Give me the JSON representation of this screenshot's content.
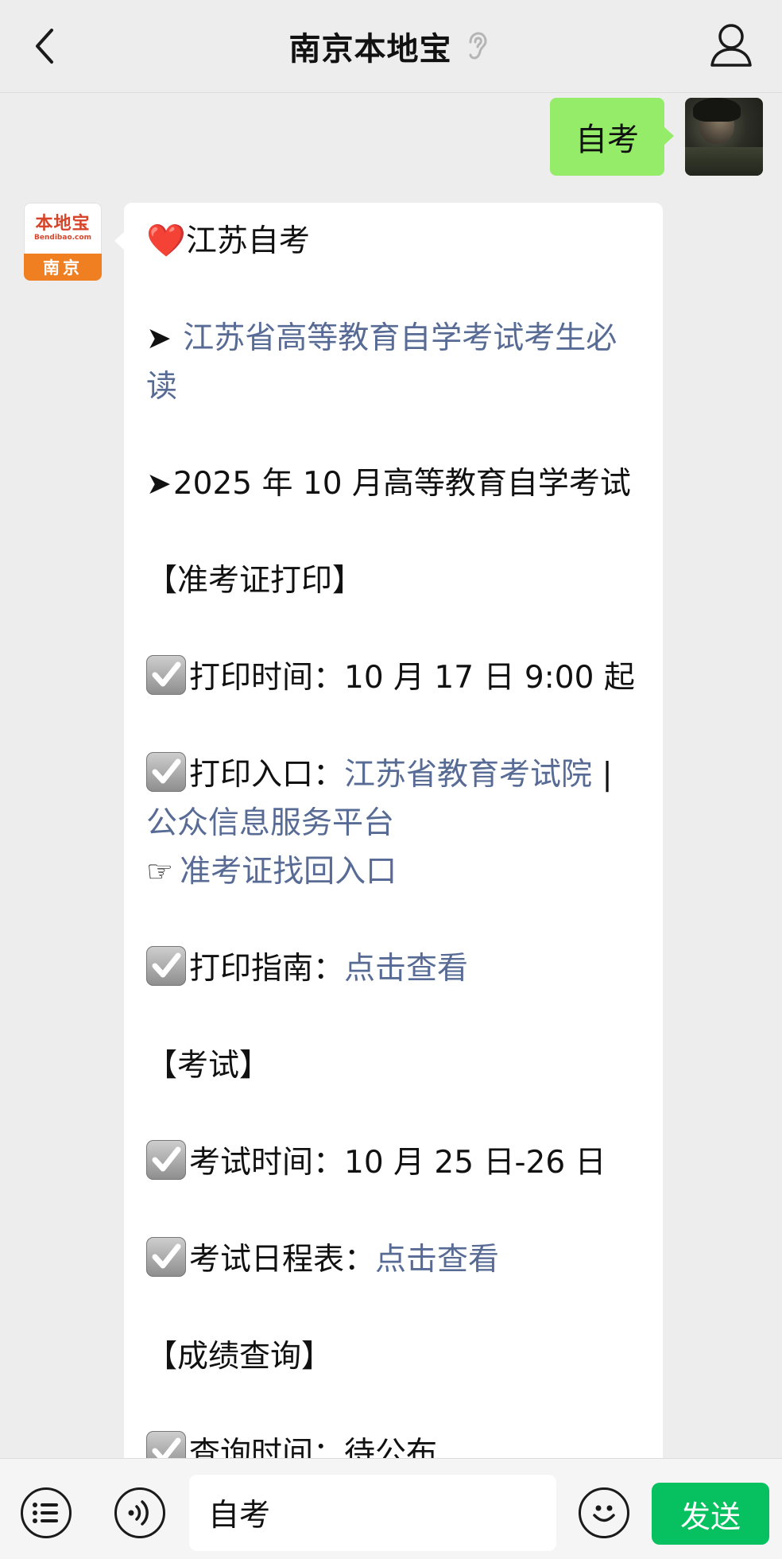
{
  "header": {
    "title": "南京本地宝"
  },
  "chat": {
    "self_message": "自考",
    "bot_avatar": {
      "logo_main": "本地宝",
      "logo_sub": "Bendibao.com",
      "logo_city": "南京"
    },
    "bot_message": {
      "heading": "江苏自考",
      "arrow1": "➤",
      "link_must_read": "江苏省高等教育自学考试考生必读",
      "arrow2": "➤",
      "exam_title": "2025 年 10 月高等教育自学考试",
      "section_admission": "【准考证打印】",
      "print_time_label": "打印时间：",
      "print_time_value": "10 月 17 日 9:00 起",
      "print_entry_label": "打印入口：",
      "print_entry_link1": "江苏省教育考试院",
      "separator": "|",
      "print_entry_link2": "公众信息服务平台",
      "pointer": "☞",
      "retrieve_link": "准考证找回入口",
      "print_guide_label": "打印指南：",
      "print_guide_link": "点击查看",
      "section_exam": "【考试】",
      "exam_time_label": "考试时间：",
      "exam_time_value": "10 月 25 日-26 日",
      "exam_schedule_label": "考试日程表：",
      "exam_schedule_link": "点击查看",
      "section_score": "【成绩查询】",
      "score_time_label": "查询时间：",
      "score_time_value": "待公布"
    }
  },
  "inputbar": {
    "input_value": "自考",
    "send_label": "发送"
  },
  "colors": {
    "self_bubble": "#95ec69",
    "link": "#576b95",
    "send_button": "#07c160"
  }
}
